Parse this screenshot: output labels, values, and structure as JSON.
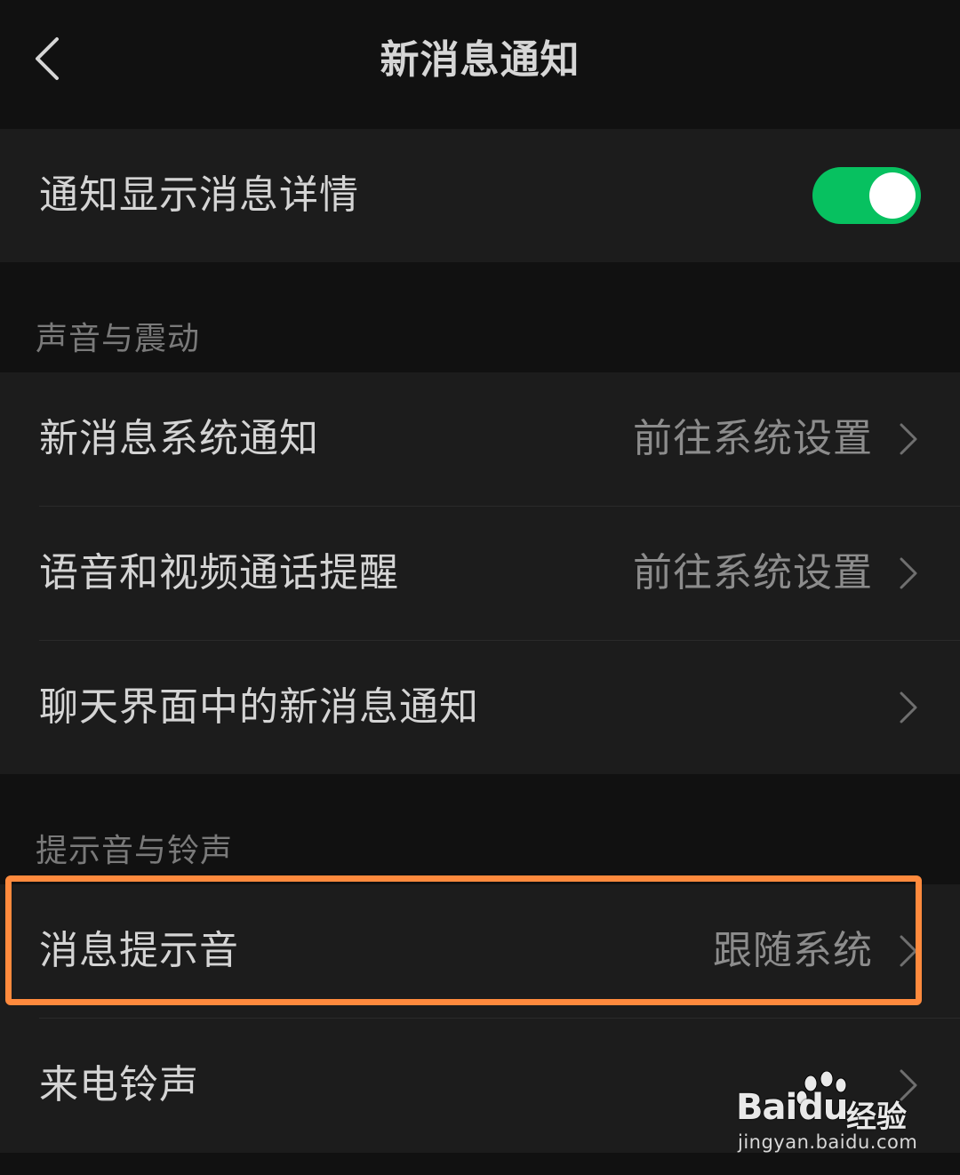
{
  "header": {
    "title": "新消息通知",
    "back_icon": "chevron-left-icon"
  },
  "group1": {
    "show_details_label": "通知显示消息详情",
    "show_details_toggle_on": true,
    "toggle_color": "#07c160"
  },
  "sections": {
    "sound_vibration": "声音与震动",
    "tone_ringtone": "提示音与铃声"
  },
  "group2": {
    "items": [
      {
        "label": "新消息系统通知",
        "value": "前往系统设置"
      },
      {
        "label": "语音和视频通话提醒",
        "value": "前往系统设置"
      },
      {
        "label": "聊天界面中的新消息通知",
        "value": ""
      }
    ]
  },
  "group3": {
    "items": [
      {
        "label": "消息提示音",
        "value": "跟随系统"
      },
      {
        "label": "来电铃声",
        "value": ""
      }
    ]
  },
  "highlight_color": "#ff8a3d",
  "watermark": {
    "logo_bai": "Bai",
    "logo_du": "du",
    "logo_jingyan": "经验",
    "url": "jingyan.baidu.com"
  }
}
